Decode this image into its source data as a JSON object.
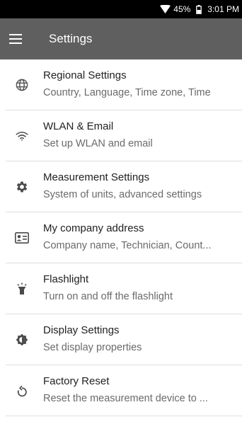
{
  "status_bar": {
    "battery": "45%",
    "time": "3:01 PM",
    "icons": [
      "wifi-icon",
      "battery-icon"
    ]
  },
  "app_bar": {
    "title": "Settings",
    "menu_icon": "hamburger-menu-icon"
  },
  "settings": [
    {
      "icon": "globe-icon",
      "title": "Regional Settings",
      "subtitle": "Country, Language, Time zone, Time"
    },
    {
      "icon": "wifi-icon",
      "title": "WLAN & Email",
      "subtitle": "Set up WLAN and email"
    },
    {
      "icon": "gear-icon",
      "title": "Measurement Settings",
      "subtitle": "System of units, advanced settings"
    },
    {
      "icon": "contact-card-icon",
      "title": "My company address",
      "subtitle": "Company name, Technician, Count..."
    },
    {
      "icon": "flashlight-icon",
      "title": "Flashlight",
      "subtitle": "Turn on and off the flashlight"
    },
    {
      "icon": "brightness-icon",
      "title": "Display Settings",
      "subtitle": "Set display properties"
    },
    {
      "icon": "reset-icon",
      "title": "Factory Reset",
      "subtitle": "Reset the measurement device to ..."
    }
  ]
}
